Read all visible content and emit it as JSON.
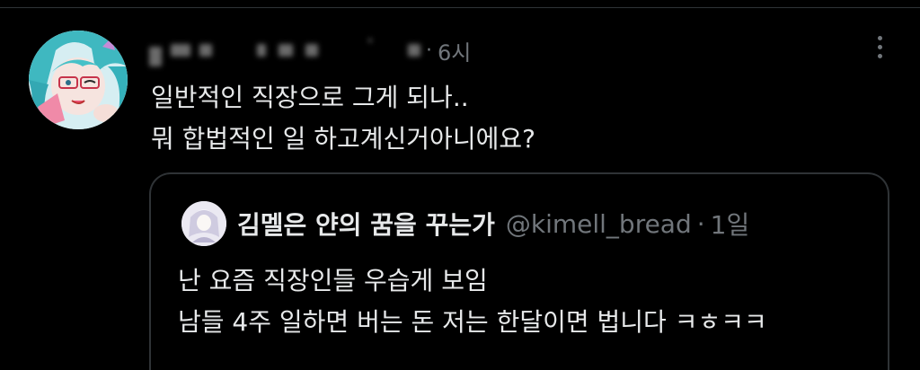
{
  "tweet": {
    "time": "6시",
    "separator": "·",
    "text_lines": [
      "일반적인 직장으로 그게 되나..",
      "뭐 합법적인 일 하고계신거아니에요?"
    ]
  },
  "quote": {
    "name": "김멜은 얀의 꿈을 꾸는가",
    "handle": "@kimell_bread",
    "separator": "·",
    "time": "1일",
    "text_lines": [
      "난 요즘 직장인들 우습게 보임",
      "남들 4주 일하면 버는 돈 저는 한달이면 법니다 ㅋㅎㅋㅋ"
    ]
  },
  "colors": {
    "background": "#000000",
    "text": "#e7e9ea",
    "muted": "#71767b",
    "border": "#2f3336"
  },
  "icons": {
    "more": "more-horizontal-icon"
  }
}
